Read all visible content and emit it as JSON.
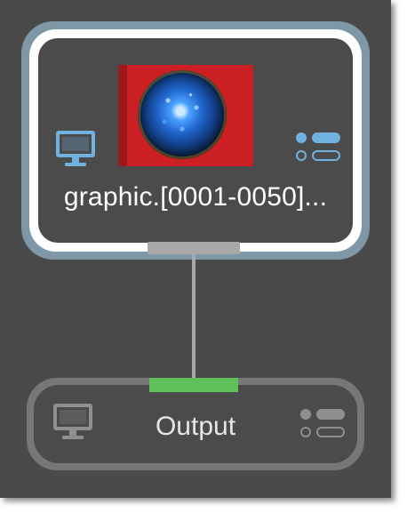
{
  "nodes": {
    "source": {
      "label": "graphic.[0001-0050]...",
      "state": "selected"
    },
    "output": {
      "label": "Output",
      "input_port_color": "#5fc15a"
    }
  },
  "colors": {
    "canvas": "#4a4a4a",
    "selection_outline": "#7f98a8",
    "accent_icon": "#6fb1df",
    "connection": "#a8a8a8"
  },
  "icons": {
    "source_left": "monitor-icon",
    "source_right": "list-icon",
    "output_left": "monitor-icon",
    "output_right": "list-icon"
  }
}
